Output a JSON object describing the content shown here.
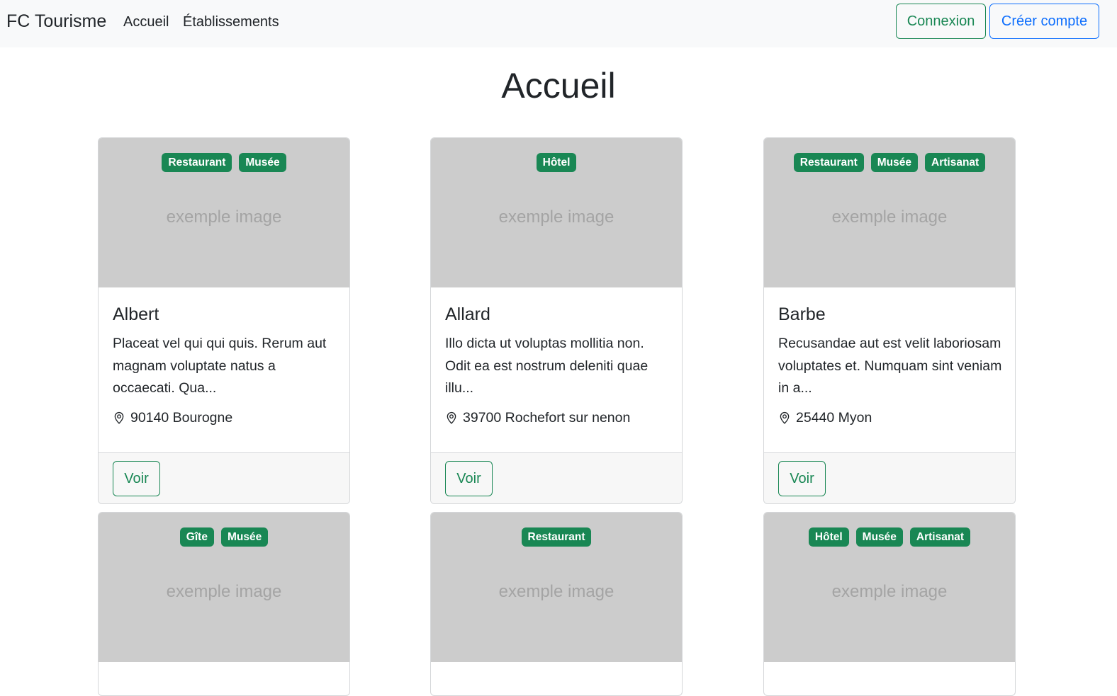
{
  "navbar": {
    "brand": "FC Tourisme",
    "links": [
      "Accueil",
      "Établissements"
    ],
    "login": "Connexion",
    "register": "Créer compte"
  },
  "page": {
    "title": "Accueil"
  },
  "colors": {
    "accent": "#198754",
    "primary": "#0d6efd",
    "placeholder": "#cccccc"
  },
  "cards": [
    {
      "badges": [
        "Restaurant",
        "Musée"
      ],
      "image_text": "exemple image",
      "title": "Albert",
      "text": "Placeat vel qui qui quis. Rerum aut magnam voluptate natus a occaecati. Qua...",
      "location": "90140 Bourogne",
      "button": "Voir"
    },
    {
      "badges": [
        "Hôtel"
      ],
      "image_text": "exemple image",
      "title": "Allard",
      "text": "Illo dicta ut voluptas mollitia non. Odit ea est nostrum deleniti quae illu...",
      "location": "39700 Rochefort sur nenon",
      "button": "Voir"
    },
    {
      "badges": [
        "Restaurant",
        "Musée",
        "Artisanat"
      ],
      "image_text": "exemple image",
      "title": "Barbe",
      "text": "Recusandae aut est velit laboriosam voluptates et. Numquam sint veniam in a...",
      "location": "25440 Myon",
      "button": "Voir"
    },
    {
      "badges": [
        "Gîte",
        "Musée"
      ],
      "image_text": "exemple image"
    },
    {
      "badges": [
        "Restaurant"
      ],
      "image_text": "exemple image"
    },
    {
      "badges": [
        "Hôtel",
        "Musée",
        "Artisanat"
      ],
      "image_text": "exemple image"
    }
  ]
}
